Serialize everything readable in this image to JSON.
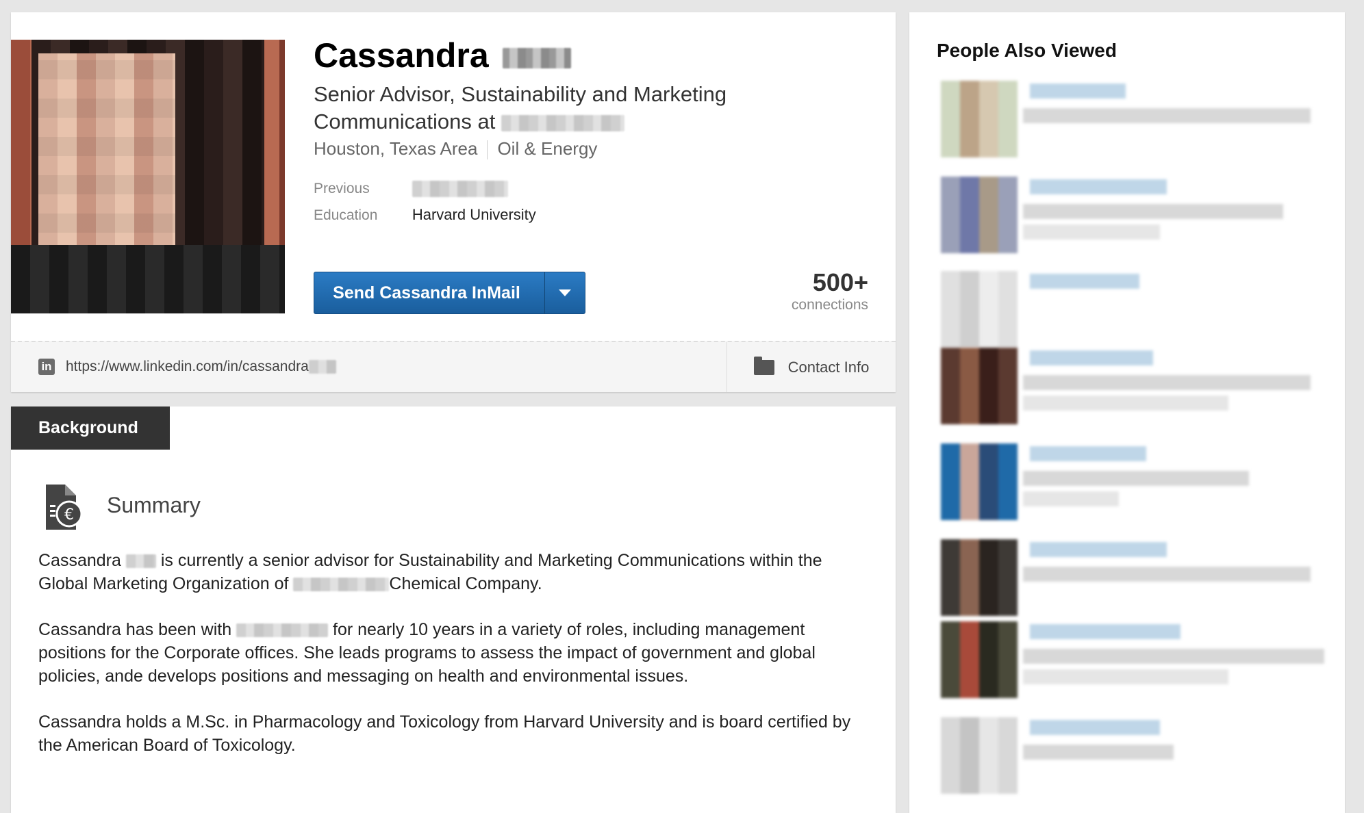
{
  "profile": {
    "first_name": "Cassandra",
    "headline": "Senior Advisor, Sustainability and Marketing Communications at",
    "location": "Houston, Texas Area",
    "industry": "Oil & Energy",
    "previous_label": "Previous",
    "education_label": "Education",
    "education_value": "Harvard University",
    "inmail_button": "Send Cassandra InMail",
    "connections_count": "500+",
    "connections_label": "connections",
    "profile_url": "https://www.linkedin.com/in/cassandra",
    "contact_info": "Contact Info",
    "linkedin_icon": "in"
  },
  "background": {
    "tab_label": "Background",
    "summary_heading": "Summary",
    "p1_a": "Cassandra",
    "p1_b": "is currently a senior advisor for Sustainability and Marketing Communications within the Global Marketing Organization of",
    "p1_c": "Chemical Company.",
    "p2_a": "Cassandra has been with",
    "p2_b": "for nearly 10 years in a variety of roles, including management positions for the Corporate offices. She leads programs to assess the impact of government and global policies, ande develops positions and messaging on health and environmental issues.",
    "p3": "Cassandra holds a M.Sc. in Pharmacology and Toxicology from Harvard University and is board certified by the American Board of Toxicology."
  },
  "sidebar": {
    "title": "People Also Viewed"
  },
  "colors": {
    "accent": "#1a5e9d",
    "tab_bg": "#333333",
    "page_bg": "#e6e6e6"
  }
}
